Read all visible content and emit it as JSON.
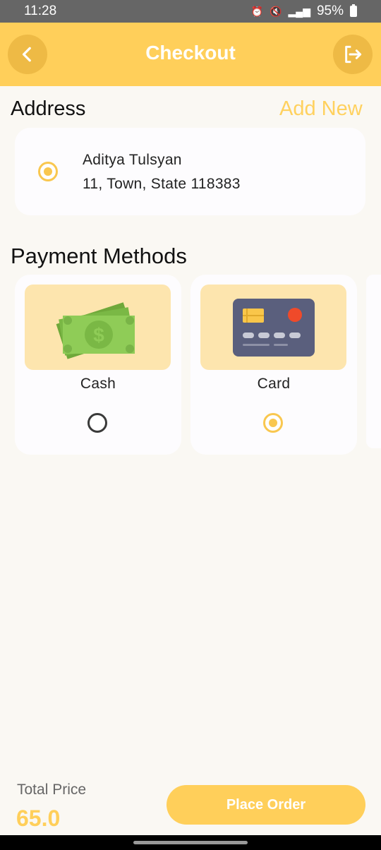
{
  "status_bar": {
    "time": "11:28",
    "battery": "95%",
    "icons": [
      "alarm-icon",
      "mute-icon",
      "volte-icon",
      "5g-icon",
      "signal-icon",
      "battery-icon"
    ]
  },
  "app_bar": {
    "title": "Checkout",
    "back_icon": "chevron-left-icon",
    "logout_icon": "logout-icon"
  },
  "address": {
    "title": "Address",
    "add_new": "Add New",
    "entries": [
      {
        "name": "Aditya Tulsyan",
        "line": "11, Town, State 118383",
        "selected": true
      }
    ]
  },
  "payment": {
    "title": "Payment Methods",
    "methods": [
      {
        "label": "Cash",
        "icon": "cash-icon",
        "selected": false
      },
      {
        "label": "Card",
        "icon": "credit-card-icon",
        "selected": true
      }
    ]
  },
  "footer": {
    "total_label": "Total Price",
    "total_value": "65.0",
    "place_order": "Place Order"
  },
  "colors": {
    "accent": "#ffcf5a",
    "accent_dark": "#eeba45",
    "card_bg": "#fdfcfe",
    "page_bg": "#faf8f3"
  }
}
